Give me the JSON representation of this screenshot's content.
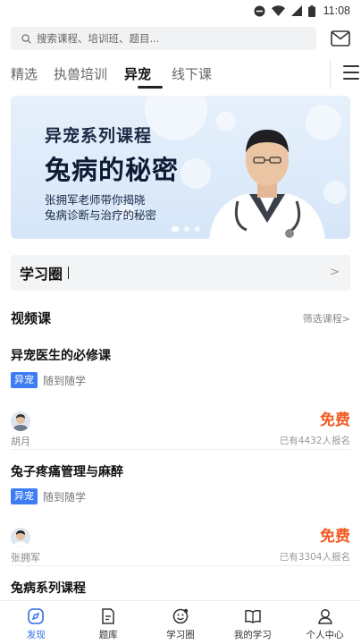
{
  "status_bar": {
    "time": "11:08"
  },
  "search": {
    "placeholder": "搜索课程、培训班、题目..."
  },
  "tabs": [
    {
      "label": "精选"
    },
    {
      "label": "执兽培训"
    },
    {
      "label": "异宠",
      "active": true
    },
    {
      "label": "线下课"
    }
  ],
  "banner": {
    "series": "异宠系列课程",
    "title": "兔病的秘密",
    "desc_line1": "张拥军老师带你揭晓",
    "desc_line2": "兔病诊断与治疗的秘密"
  },
  "circle_card": {
    "label": "学习圈",
    "chevron": ">"
  },
  "video_section": {
    "title": "视频课",
    "more": "筛选课程>"
  },
  "courses": [
    {
      "title": "异宠医生的必修课",
      "tag": "异宠",
      "tag_text": "随到随学",
      "teacher": "胡月",
      "price": "免费",
      "enroll": "已有4432人报名"
    },
    {
      "title": "兔子疼痛管理与麻醉",
      "tag": "异宠",
      "tag_text": "随到随学",
      "teacher": "张拥军",
      "price": "免费",
      "enroll": "已有3304人报名"
    },
    {
      "title": "兔病系列课程"
    }
  ],
  "bottom_nav": [
    {
      "label": "发现",
      "icon": "discover-icon",
      "active": true
    },
    {
      "label": "题库",
      "icon": "question-bank-icon"
    },
    {
      "label": "学习圈",
      "icon": "study-circle-icon"
    },
    {
      "label": "我的学习",
      "icon": "my-study-icon"
    },
    {
      "label": "个人中心",
      "icon": "profile-icon"
    }
  ],
  "colors": {
    "accent": "#2f6fe8",
    "price": "#f25a24",
    "tag": "#3d7cf2"
  }
}
